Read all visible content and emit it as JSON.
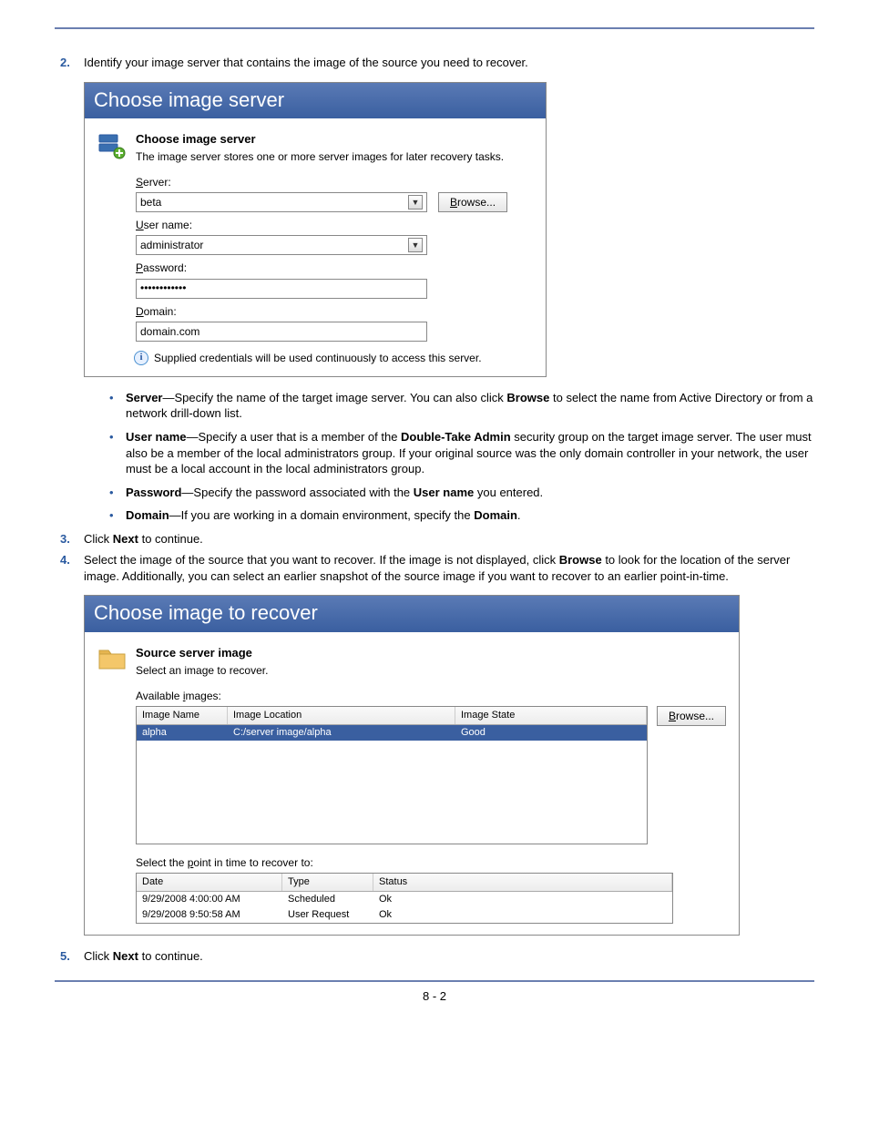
{
  "page_footer": "8 - 2",
  "steps": {
    "s2": {
      "num": "2.",
      "text": "Identify your image server that contains the image of the source you need to recover."
    },
    "s3": {
      "num": "3.",
      "prefix": "Click ",
      "bold": "Next",
      "suffix": " to continue."
    },
    "s4": {
      "num": "4.",
      "prefix": "Select the image of the source that you want to recover. If the image is not displayed, click ",
      "bold": "Browse",
      "suffix": " to look for the location of the server image. Additionally, you can select an earlier snapshot of the source image if you want to recover to an earlier point-in-time."
    },
    "s5": {
      "num": "5.",
      "prefix": "Click ",
      "bold": "Next",
      "suffix": " to continue."
    }
  },
  "bullets": {
    "server": {
      "lead": "Server",
      "dash": "—Specify the name of the target image server. You can also click ",
      "b1": "Browse",
      "tail": " to select the name from Active Directory or from a network drill-down list."
    },
    "user": {
      "lead": "User name",
      "dash": "—Specify a user that is a member of the ",
      "b1": "Double-Take Admin",
      "tail": " security group on the target image server. The user must also be a member of the local administrators group. If your original source was the only domain controller in your network, the user must be a local account in the local administrators group."
    },
    "pass": {
      "lead": "Password",
      "dash": "—Specify the password associated with the ",
      "b1": "User name",
      "tail": " you entered."
    },
    "domain": {
      "lead": "Domain",
      "dash": "—If you are working in a domain environment, specify the ",
      "b1": "Domain",
      "tail": "."
    }
  },
  "ss1": {
    "title": "Choose image server",
    "heading": "Choose image server",
    "sub": "The image server stores one or more server images for later recovery tasks.",
    "labels": {
      "server_pre": "S",
      "server_post": "erver:",
      "user_pre": "U",
      "user_post": "ser name:",
      "pass_pre": "P",
      "pass_post": "assword:",
      "domain_pre": "D",
      "domain_post": "omain:"
    },
    "values": {
      "server": "beta",
      "user": "administrator",
      "password": "••••••••••••",
      "domain": "domain.com"
    },
    "browse_pre": "B",
    "browse_post": "rowse...",
    "info": "Supplied credentials will be used continuously to access this server."
  },
  "ss2": {
    "title": "Choose image to recover",
    "heading": "Source server image",
    "sub": "Select an image to recover.",
    "avail_label_pre": "Available ",
    "avail_label_u": "i",
    "avail_label_post": "mages:",
    "browse_pre": "B",
    "browse_post": "rowse...",
    "tbl1": {
      "h1": "Image Name",
      "h2": "Image Location",
      "h3": "Image State",
      "r1c1": "alpha",
      "r1c2": "C:/server image/alpha",
      "r1c3": "Good"
    },
    "point_label_pre": "Select the ",
    "point_label_u": "p",
    "point_label_post": "oint in time to recover to:",
    "tbl2": {
      "h1": "Date",
      "h2": "Type",
      "h3": "Status",
      "rows": [
        {
          "c1": "9/29/2008 4:00:00 AM",
          "c2": "Scheduled",
          "c3": "Ok"
        },
        {
          "c1": "9/29/2008 9:50:58 AM",
          "c2": "User Request",
          "c3": "Ok"
        }
      ]
    }
  }
}
